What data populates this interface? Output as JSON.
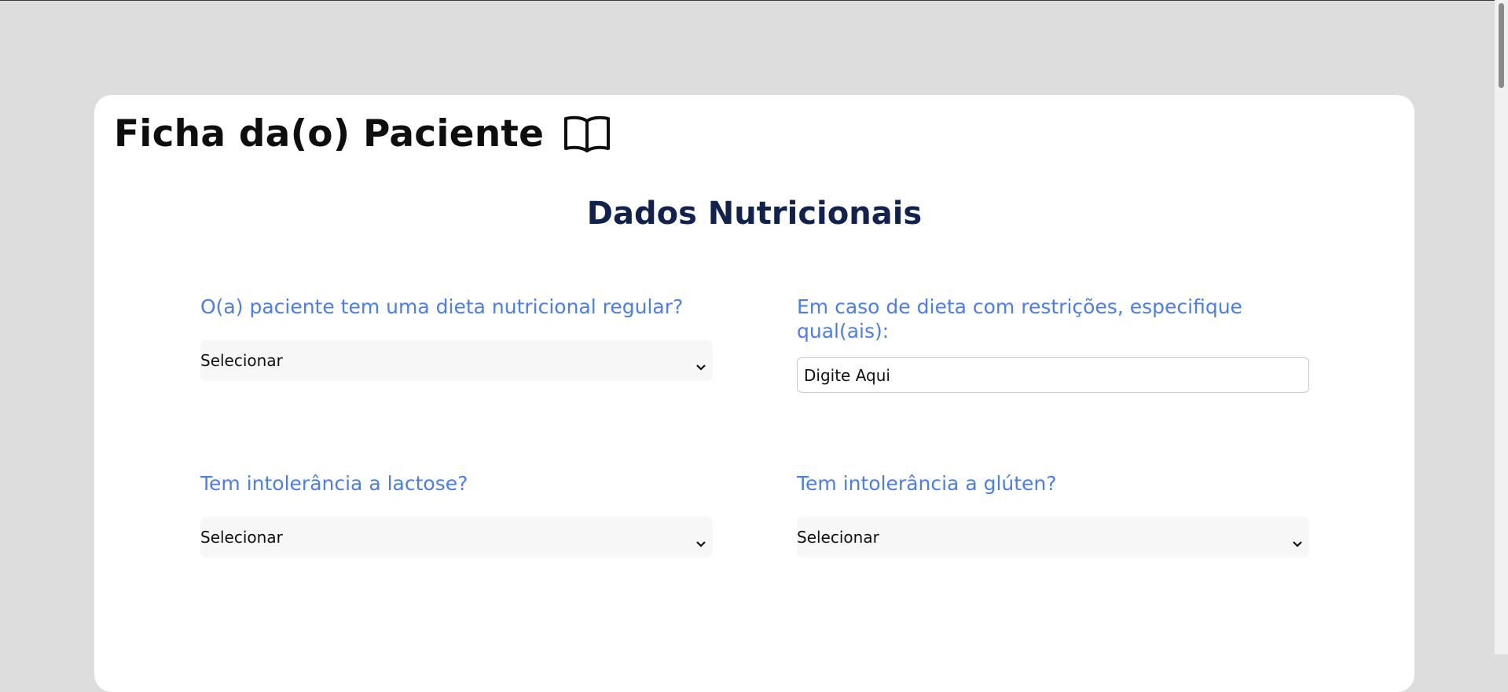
{
  "header": {
    "title": "Ficha da(o) Paciente",
    "icon": "book-open-icon"
  },
  "section": {
    "title": "Dados Nutricionais"
  },
  "fields": {
    "dieta_regular": {
      "label": "O(a) paciente tem uma dieta nutricional regular?",
      "value": "Selecionar"
    },
    "restricoes": {
      "label": "Em caso de dieta com restrições, especifique qual(ais):",
      "placeholder": "Digite Aqui"
    },
    "lactose": {
      "label": "Tem intolerância a lactose?",
      "value": "Selecionar"
    },
    "gluten": {
      "label": "Tem intolerância a glúten?",
      "value": "Selecionar"
    }
  },
  "colors": {
    "label": "#4a7df0",
    "section_title": "#12224e",
    "background": "#dddddd"
  }
}
